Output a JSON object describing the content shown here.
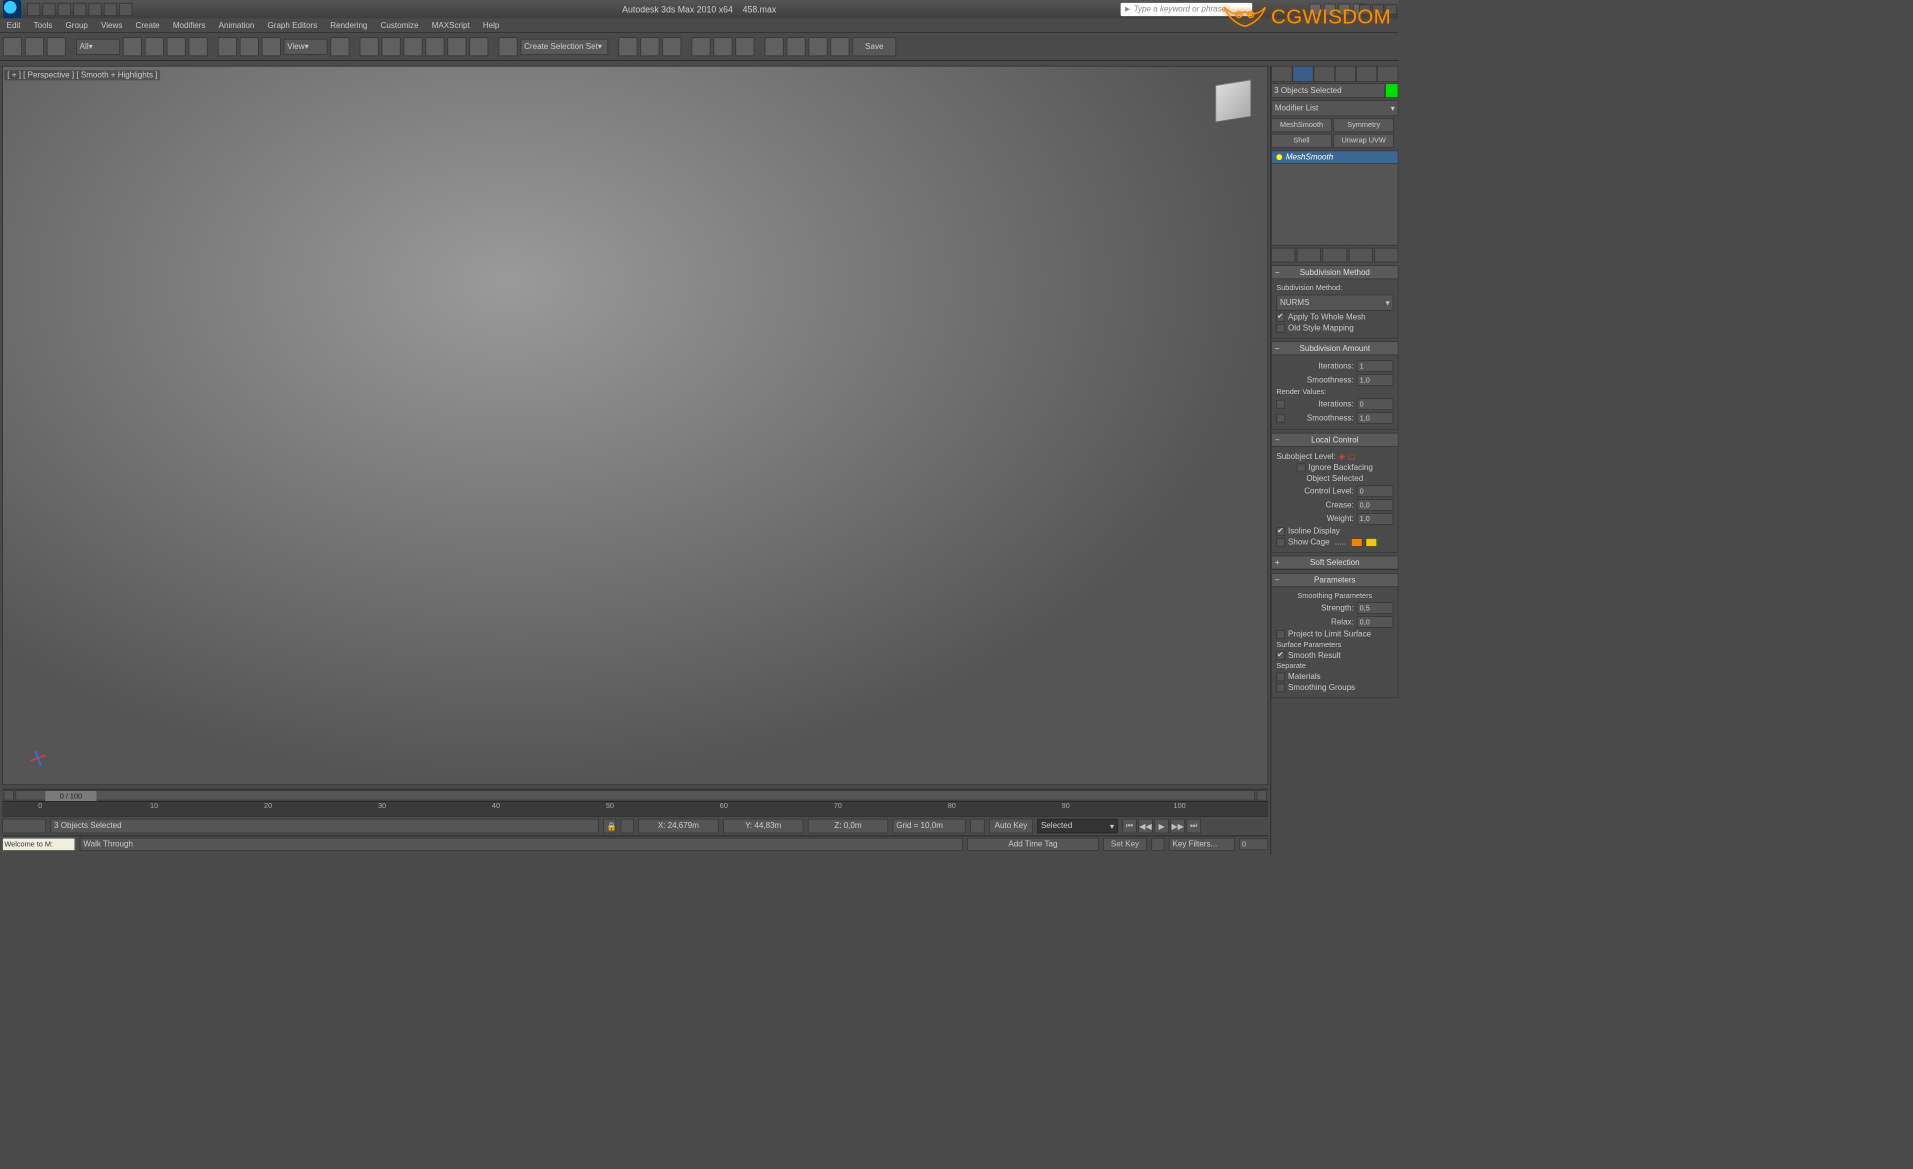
{
  "title": {
    "app": "Autodesk 3ds Max 2010 x64",
    "file": "458.max"
  },
  "search_placeholder": "Type a keyword or phrase",
  "menu": [
    "Edit",
    "Tools",
    "Group",
    "Views",
    "Create",
    "Modifiers",
    "Animation",
    "Graph Editors",
    "Rendering",
    "Customize",
    "MAXScript",
    "Help"
  ],
  "toolbar": {
    "filter": "All",
    "view_dd": "View",
    "selset_dd": "Create Selection Set",
    "save": "Save"
  },
  "viewport_label": "[ + ] [ Perspective ] [ Smooth + Highlights ]",
  "watermark": "CGWISDOM",
  "cmd": {
    "objects_selected": "3 Objects Selected",
    "modifier_list_label": "Modifier List",
    "mod_buttons": [
      "MeshSmooth",
      "Symmetry",
      "Shell",
      "Unwrap UVW"
    ],
    "stack_item": "MeshSmooth",
    "rollouts": {
      "subdiv_method": {
        "title": "Subdivision Method",
        "label": "Subdivision Method:",
        "value": "NURMS",
        "apply_whole": "Apply To Whole Mesh",
        "old_style": "Old Style Mapping"
      },
      "subdiv_amount": {
        "title": "Subdivision Amount",
        "iterations_label": "Iterations:",
        "iterations": "1",
        "smoothness_label": "Smoothness:",
        "smoothness": "1,0",
        "render_values": "Render Values:",
        "r_iterations": "0",
        "r_smoothness": "1,0"
      },
      "local_control": {
        "title": "Local Control",
        "subobj_label": "Subobject Level:",
        "ignore_backfacing": "Ignore Backfacing",
        "object_selected": "Object Selected",
        "control_level_label": "Control Level:",
        "control_level": "0",
        "crease_label": "Crease:",
        "crease": "0,0",
        "weight_label": "Weight:",
        "weight": "1,0",
        "isoline": "Isoline Display",
        "show_cage": "Show Cage"
      },
      "soft_selection": "Soft Selection",
      "parameters": {
        "title": "Parameters",
        "smoothing_parameters": "Smoothing Parameters",
        "strength_label": "Strength:",
        "strength": "0,5",
        "relax_label": "Relax:",
        "relax": "0,0",
        "project_limit": "Project to Limit Surface",
        "surface_parameters": "Surface Parameters",
        "smooth_result": "Smooth Result",
        "separate": "Separate",
        "sep_materials": "Materials",
        "sep_smoothing": "Smoothing Groups"
      }
    }
  },
  "timeline": {
    "current": "0 / 100",
    "ticks": [
      0,
      10,
      20,
      30,
      40,
      50,
      60,
      70,
      80,
      90,
      100
    ]
  },
  "status": {
    "selection": "3 Objects Selected",
    "x": "24,679m",
    "y": "44,83m",
    "z": "0,0m",
    "grid": "Grid = 10,0m",
    "autokey": "Auto Key",
    "setkey": "Set Key",
    "selected_dd": "Selected",
    "keyfilters": "Key Filters...",
    "add_time_tag": "Add Time Tag",
    "maxscript": "Welcome to M:",
    "prompt": "Walk Through"
  }
}
